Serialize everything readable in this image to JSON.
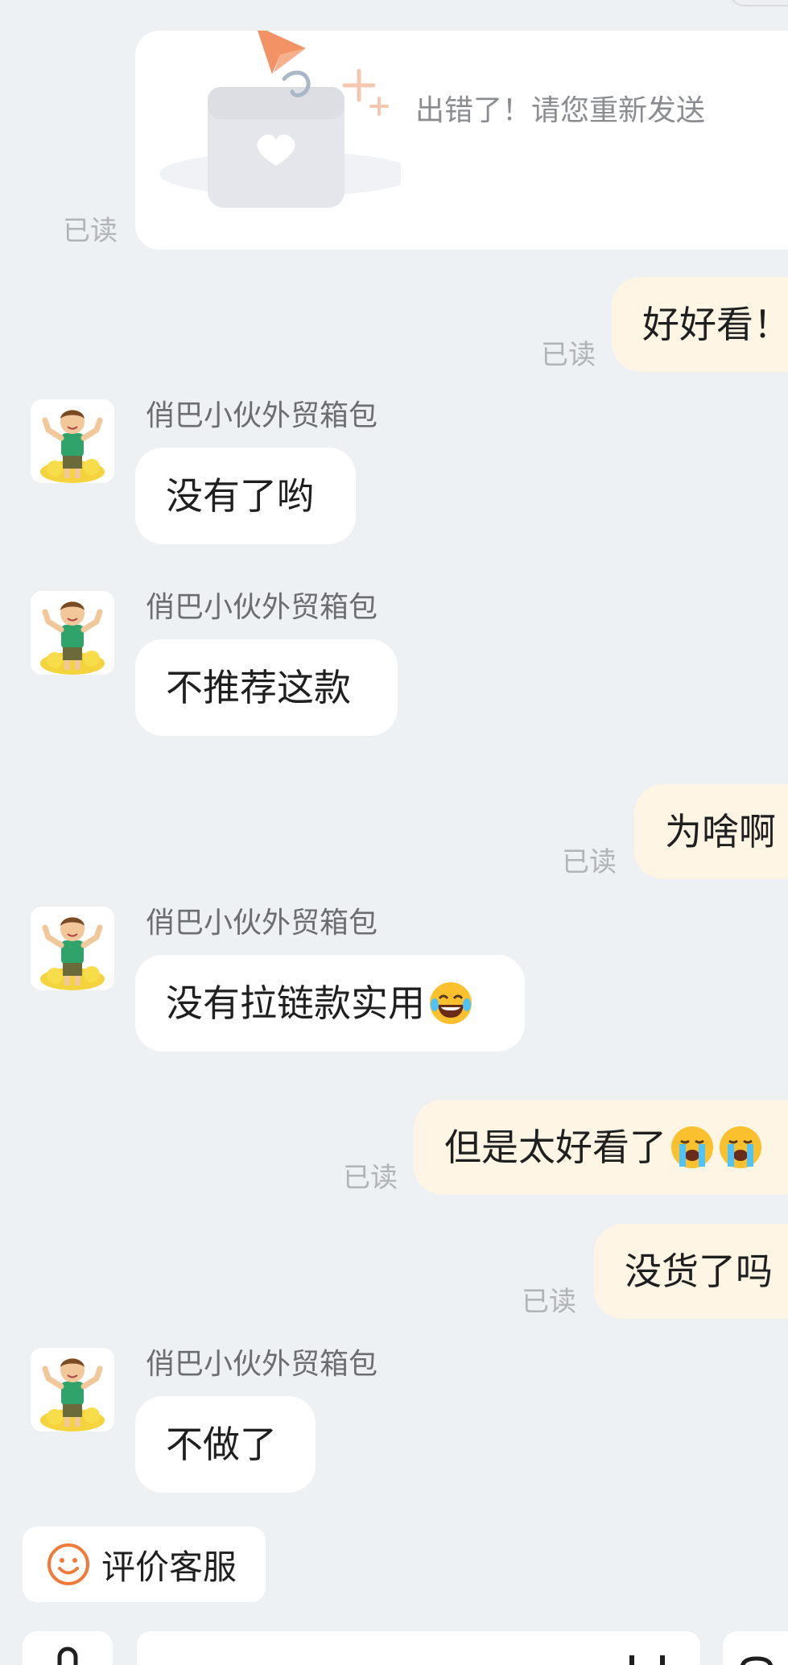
{
  "error_card": {
    "message": "出错了！请您重新发送",
    "read_label": "已读"
  },
  "messages": [
    {
      "direction": "out",
      "text": "好好看！",
      "read": "已读"
    },
    {
      "direction": "in",
      "sender": "俏巴小伙外贸箱包",
      "text": "没有了哟"
    },
    {
      "direction": "in",
      "sender": "俏巴小伙外贸箱包",
      "text": "不推荐这款"
    },
    {
      "direction": "out",
      "text": "为啥啊",
      "read": "已读"
    },
    {
      "direction": "in",
      "sender": "俏巴小伙外贸箱包",
      "text": "没有拉链款实用",
      "emoji": "face-with-tears-of-joy"
    },
    {
      "direction": "out",
      "text": "但是太好看了",
      "emoji": "loudly-crying-face x2",
      "read": "已读"
    },
    {
      "direction": "out",
      "text": "没货了吗",
      "read": "已读"
    },
    {
      "direction": "in",
      "sender": "俏巴小伙外贸箱包",
      "text": "不做了"
    }
  ],
  "toolbar": {
    "rate_service_label": "评价客服",
    "rate_icon": "smiley-icon"
  },
  "colors": {
    "background": "#eef1f4",
    "incoming_bubble": "#ffffff",
    "outgoing_bubble": "#fff5e4",
    "accent_orange": "#f07a3a",
    "read_text": "#b0b3b8"
  }
}
